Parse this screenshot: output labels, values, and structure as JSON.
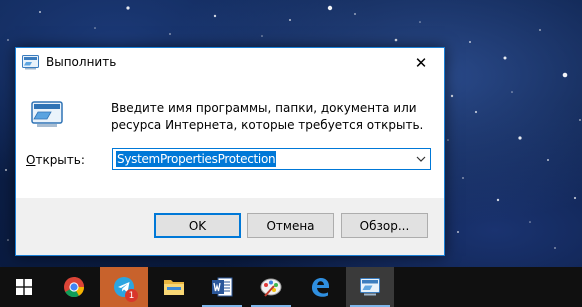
{
  "dialog": {
    "title": "Выполнить",
    "close_glyph": "✕",
    "description": "Введите имя программы, папки, документа или ресурса Интернета, которые требуется открыть.",
    "open_label_accel": "О",
    "open_label_rest": "ткрыть:",
    "input_value": "SystemPropertiesProtection",
    "buttons": {
      "ok": "OK",
      "cancel": "Отмена",
      "browse": "Обзор..."
    }
  },
  "taskbar": {
    "items": [
      {
        "name": "start-icon"
      },
      {
        "name": "chrome-icon"
      },
      {
        "name": "telegram-icon",
        "badge": "1"
      },
      {
        "name": "file-explorer-icon"
      },
      {
        "name": "word-icon"
      },
      {
        "name": "paint-icon"
      },
      {
        "name": "edge-icon"
      },
      {
        "name": "run-icon"
      }
    ]
  },
  "colors": {
    "accent": "#0078d7",
    "taskbar": "#101010",
    "telegram_highlight": "#c8622c",
    "badge": "#d9362b"
  }
}
